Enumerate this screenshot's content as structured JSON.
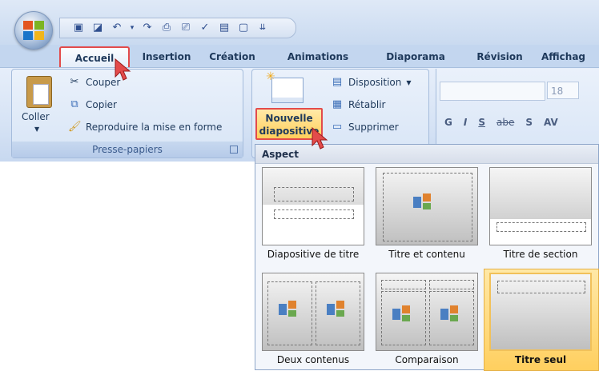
{
  "app": {
    "tabs": [
      {
        "label": "Accueil",
        "active": true
      },
      {
        "label": "Insertion"
      },
      {
        "label": "Création"
      },
      {
        "label": "Animations"
      },
      {
        "label": "Diaporama"
      },
      {
        "label": "Révision"
      },
      {
        "label": "Affichag"
      }
    ]
  },
  "ribbon": {
    "clipboard": {
      "paste_label": "Coller",
      "cut": "Couper",
      "copy": "Copier",
      "format_painter": "Reproduire la mise en forme",
      "group_label": "Presse-papiers"
    },
    "slides": {
      "new_slide_line1": "Nouvelle",
      "new_slide_line2": "diapositive",
      "layout": "Disposition",
      "reset": "Rétablir",
      "delete": "Supprimer"
    },
    "font": {
      "size": "18",
      "buttons": [
        "G",
        "I",
        "S",
        "abe",
        "S",
        "AV"
      ]
    }
  },
  "gallery": {
    "header": "Aspect",
    "items": [
      {
        "label": "Diapositive de titre"
      },
      {
        "label": "Titre et contenu"
      },
      {
        "label": "Titre de section"
      },
      {
        "label": "Deux contenus"
      },
      {
        "label": "Comparaison"
      },
      {
        "label": "Titre seul",
        "selected": true
      }
    ]
  },
  "colors": {
    "accent_red": "#e34b4b",
    "selected_fill": "#ffd56e",
    "ribbon_blue": "#c3d6ef"
  }
}
